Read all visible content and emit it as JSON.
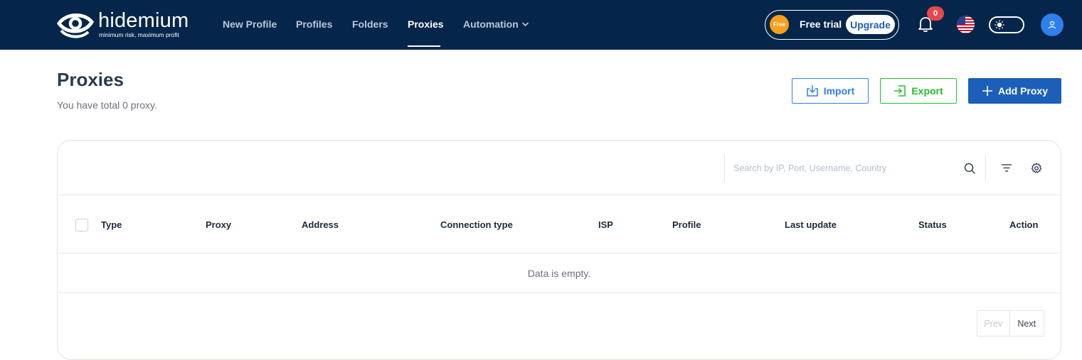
{
  "brand": {
    "name": "hidemium",
    "tagline": "minimum risk, maximum profit"
  },
  "nav": {
    "items": [
      {
        "label": "New Profile"
      },
      {
        "label": "Profiles"
      },
      {
        "label": "Folders"
      },
      {
        "label": "Proxies",
        "active": true
      },
      {
        "label": "Automation",
        "has_dropdown": true
      }
    ]
  },
  "trial": {
    "badge": "Free",
    "label": "Free trial",
    "upgrade_label": "Upgrade"
  },
  "notifications": {
    "count": "0"
  },
  "language": {
    "flag": "us-flag-icon"
  },
  "theme": {
    "mode": "light"
  },
  "page": {
    "title": "Proxies",
    "subtitle": "You have total 0 proxy."
  },
  "actions": {
    "import_label": "Import",
    "export_label": "Export",
    "add_label": "Add Proxy"
  },
  "search": {
    "placeholder": "Search by IP, Port, Username, Country",
    "value": ""
  },
  "table": {
    "columns": [
      "Type",
      "Proxy",
      "Address",
      "Connection type",
      "ISP",
      "Profile",
      "Last update",
      "Status",
      "Action"
    ],
    "rows": [],
    "empty_text": "Data is empty."
  },
  "pagination": {
    "prev_label": "Prev",
    "next_label": "Next"
  },
  "colors": {
    "navbar": "#05264a",
    "primary": "#1c5fb8",
    "import": "#2f80ed",
    "export": "#22c02f",
    "badge": "#e5484d",
    "free_badge": "#f7a01b"
  }
}
